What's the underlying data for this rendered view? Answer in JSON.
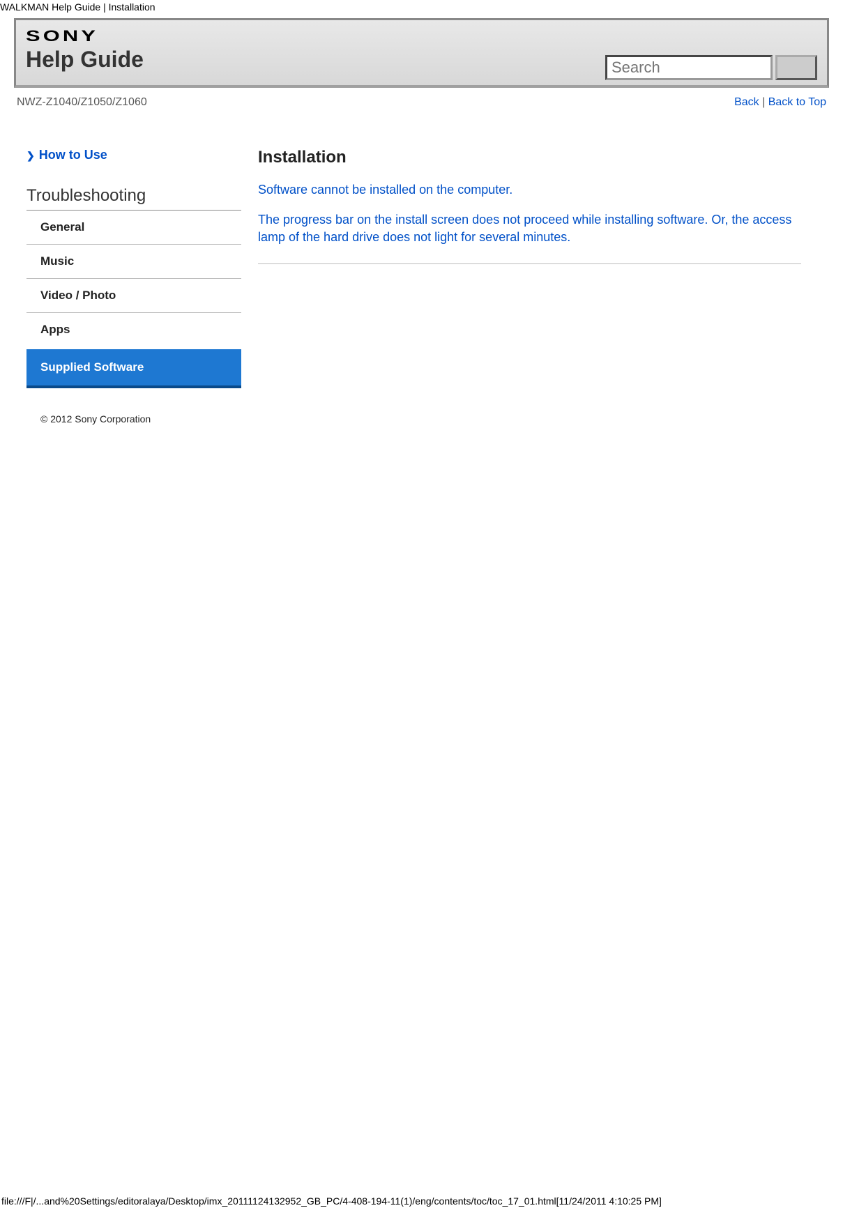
{
  "page_header": "WALKMAN Help Guide | Installation",
  "logo_text": "SONY",
  "help_guide": "Help Guide",
  "search": {
    "placeholder": "Search"
  },
  "model": "NWZ-Z1040/Z1050/Z1060",
  "links": {
    "back": "Back",
    "back_to_top": "Back to Top",
    "sep": " | "
  },
  "howto": "How to Use",
  "troubleshooting": "Troubleshooting",
  "nav": {
    "items": [
      {
        "label": "General"
      },
      {
        "label": "Music"
      },
      {
        "label": "Video / Photo"
      },
      {
        "label": "Apps"
      },
      {
        "label": "Supplied Software"
      }
    ]
  },
  "content": {
    "title": "Installation",
    "topics": [
      "Software cannot be installed on the computer.",
      "The progress bar on the install screen does not proceed while installing software. Or, the access lamp of the hard drive does not light for several minutes."
    ]
  },
  "copyright": "© 2012 Sony Corporation",
  "footer_path": "file:///F|/...and%20Settings/editoralaya/Desktop/imx_20111124132952_GB_PC/4-408-194-11(1)/eng/contents/toc/toc_17_01.html[11/24/2011 4:10:25 PM]"
}
